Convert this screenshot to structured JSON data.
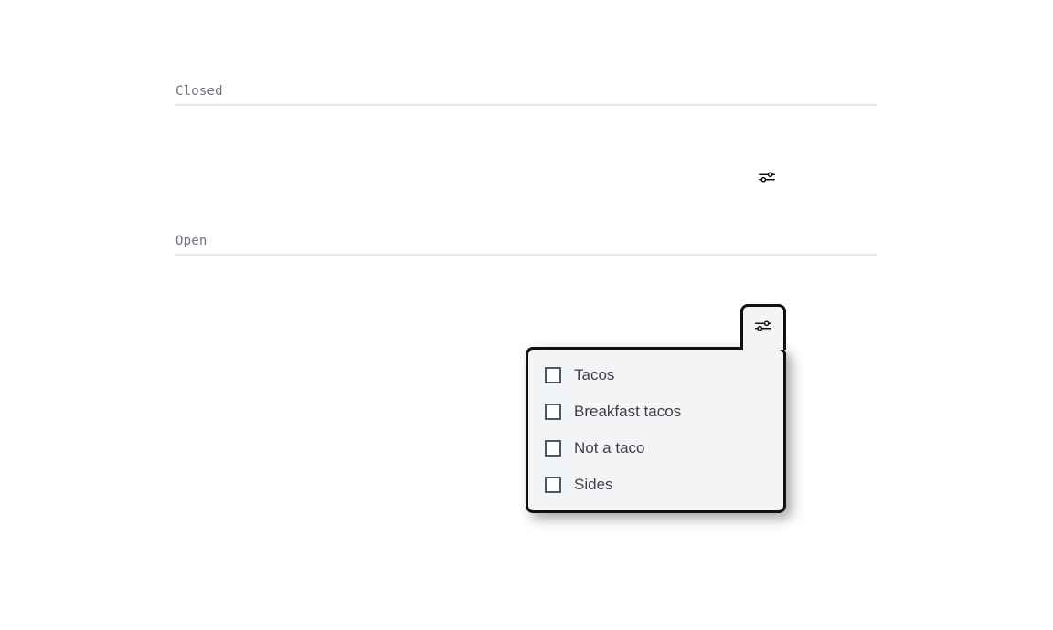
{
  "sections": {
    "closed_label": "Closed",
    "open_label": "Open"
  },
  "filters_icon_name": "sliders-icon",
  "menu": {
    "items": [
      {
        "label": "Tacos"
      },
      {
        "label": "Breakfast tacos"
      },
      {
        "label": "Not a taco"
      },
      {
        "label": "Sides"
      }
    ]
  }
}
